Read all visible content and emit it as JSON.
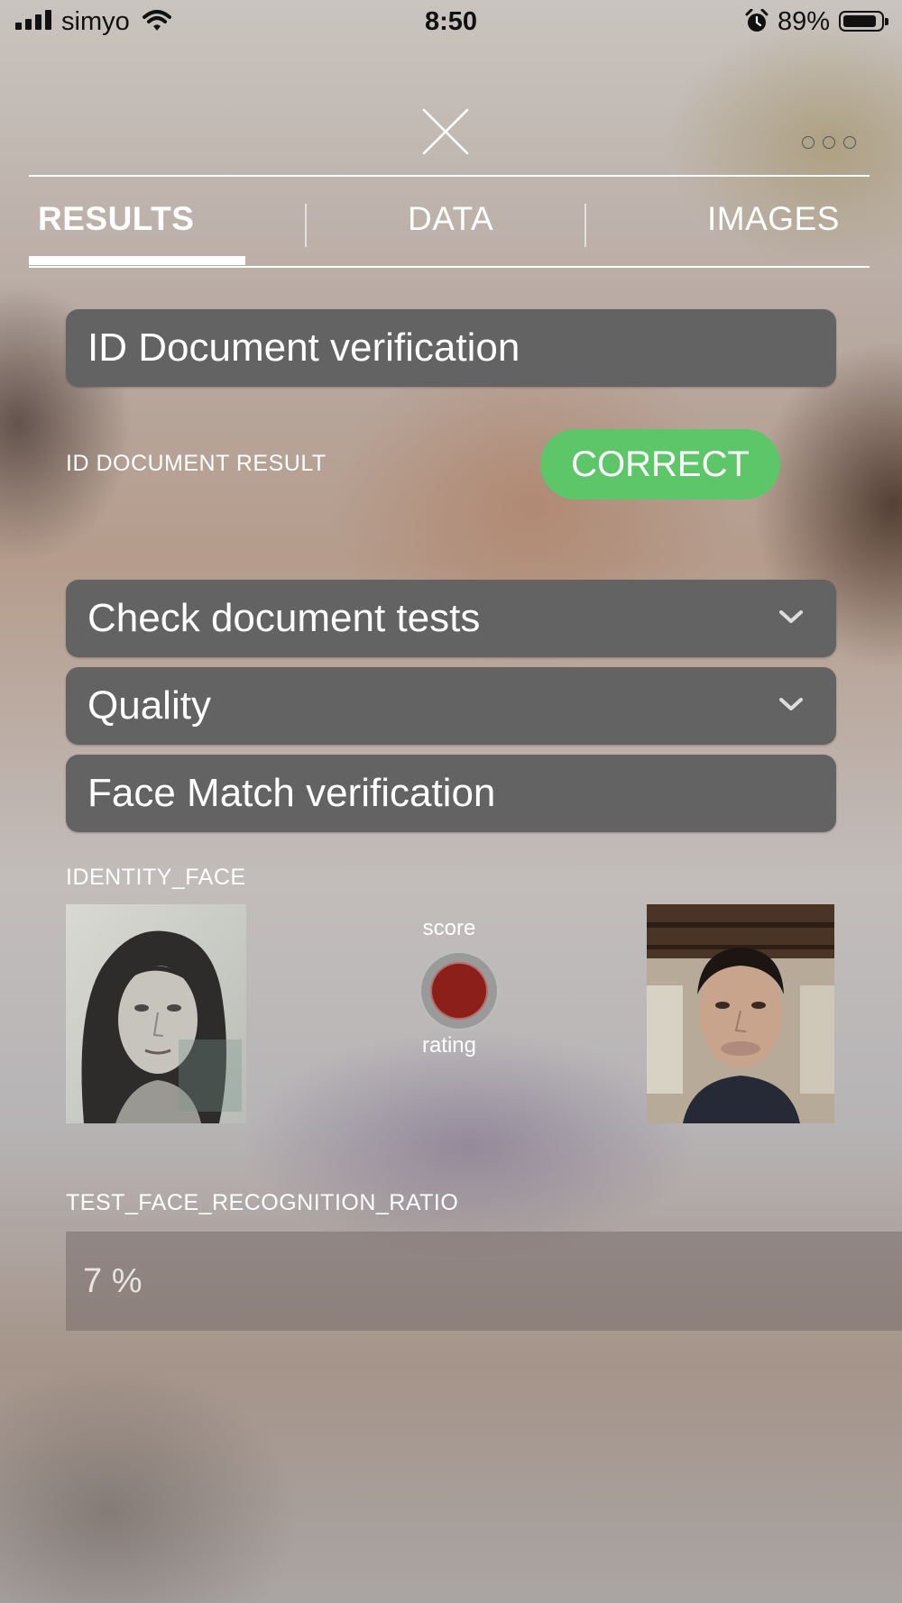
{
  "status_bar": {
    "carrier": "simyo",
    "time": "8:50",
    "battery_percent": "89%",
    "battery_level": 0.89
  },
  "tabs": [
    {
      "label": "RESULTS",
      "active": true
    },
    {
      "label": "DATA",
      "active": false
    },
    {
      "label": "IMAGES",
      "active": false
    }
  ],
  "sections": {
    "id_document": {
      "title": "ID Document verification",
      "result_label": "ID DOCUMENT RESULT",
      "result_value": "CORRECT",
      "result_color": "#5cc669"
    },
    "check_tests": {
      "title": "Check document tests"
    },
    "quality": {
      "title": "Quality"
    },
    "face_match": {
      "title": "Face Match verification",
      "identity_label": "IDENTITY_FACE",
      "score_label": "score",
      "rating_label": "rating",
      "rating_color": "#8d1f1a"
    },
    "ratio": {
      "label": "TEST_FACE_RECOGNITION_RATIO",
      "value": "7 %"
    }
  },
  "icons": [
    "close-icon",
    "more-dots-icon",
    "chevron-down-icon",
    "wifi-icon",
    "alarm-icon",
    "battery-icon",
    "signal-icon"
  ]
}
